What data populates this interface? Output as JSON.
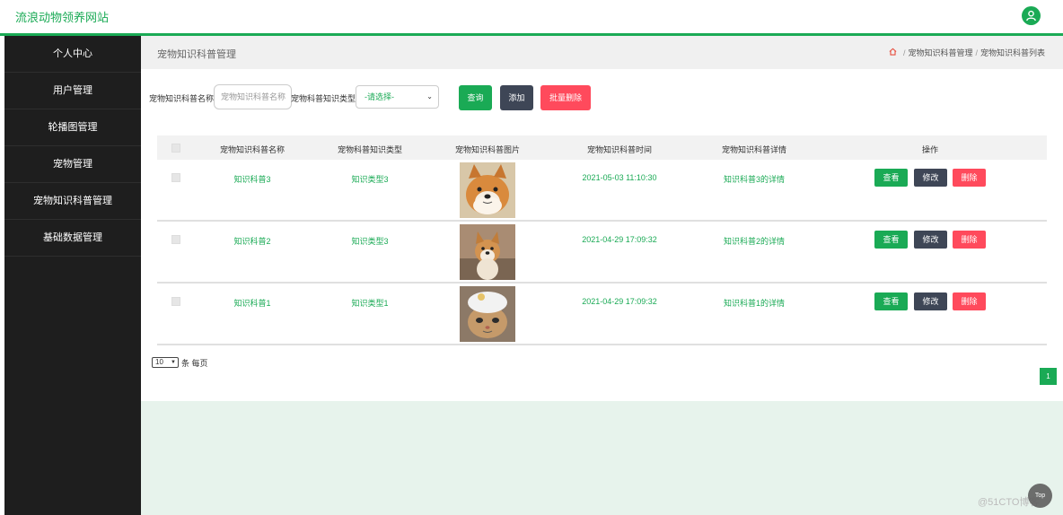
{
  "app": {
    "title": "流浪动物领养网站"
  },
  "sidebar": {
    "items": [
      {
        "label": "个人中心"
      },
      {
        "label": "用户管理"
      },
      {
        "label": "轮播图管理"
      },
      {
        "label": "宠物管理"
      },
      {
        "label": "宠物知识科普管理"
      },
      {
        "label": "基础数据管理"
      }
    ]
  },
  "header": {
    "page_title": "宠物知识科普管理",
    "breadcrumb": [
      "宠物知识科普管理",
      "宠物知识科普列表"
    ]
  },
  "search": {
    "name_label": "宠物知识科普名称",
    "name_placeholder": "宠物知识科普名称",
    "type_label": "宠物科普知识类型",
    "type_selected": "-请选择-",
    "query_button": "查询",
    "add_button": "添加",
    "batch_delete_button": "批量删除"
  },
  "table": {
    "headers": [
      "宠物知识科普名称",
      "宠物科普知识类型",
      "宠物知识科普图片",
      "宠物知识科普时间",
      "宠物知识科普详情",
      "操作"
    ],
    "rows": [
      {
        "name": "知识科普3",
        "type": "知识类型3",
        "image": "shiba-inu-photo",
        "time": "2021-05-03 11:10:30",
        "detail": "知识科普3的详情"
      },
      {
        "name": "知识科普2",
        "type": "知识类型3",
        "image": "shiba-puppy-photo",
        "time": "2021-04-29 17:09:32",
        "detail": "知识科普2的详情"
      },
      {
        "name": "知识科普1",
        "type": "知识类型1",
        "image": "cat-with-hat-photo",
        "time": "2021-04-29 17:09:32",
        "detail": "知识科普1的详情"
      }
    ],
    "actions": {
      "view": "查看",
      "edit": "修改",
      "delete": "删除"
    }
  },
  "pagination": {
    "page_size": "10",
    "per_page_label": "条 每页",
    "current_page": "1"
  },
  "misc": {
    "top_button": "Top",
    "watermark": "@51CTO博客"
  },
  "colors": {
    "primary": "#1aaa55",
    "sidebar_bg": "#1e1e1e",
    "edit": "#3e4656",
    "danger": "#ff4a5c",
    "mint_bg": "#e7f3ec"
  }
}
